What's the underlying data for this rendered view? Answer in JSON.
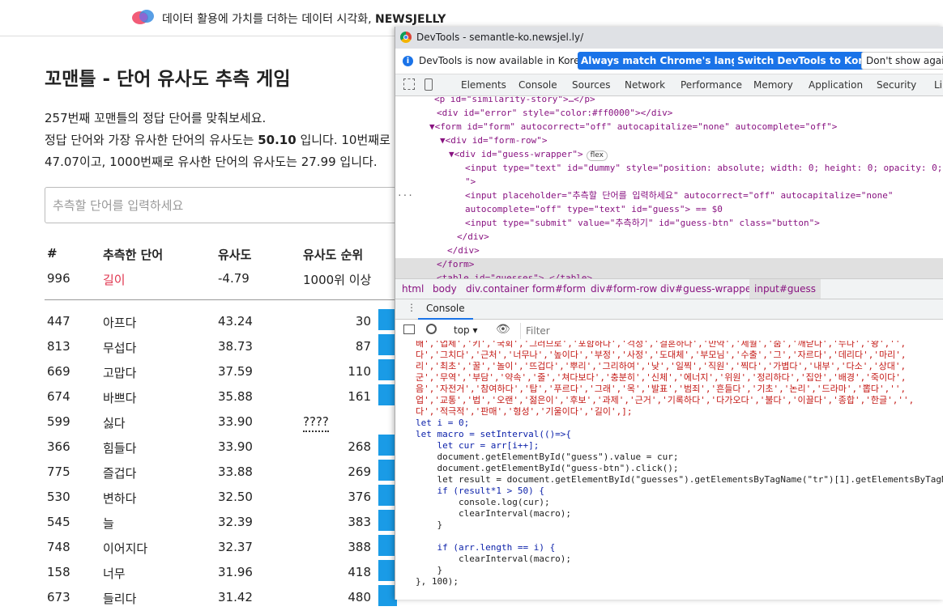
{
  "header": {
    "brand_text": "데이터 활용에 가치를 더하는 데이터 시각화, ",
    "brand_name": "NEWSJELLY"
  },
  "game": {
    "title": "꼬맨틀 - 단어 유사도 추측 게임",
    "intro_line1": "257번째 꼬맨틀의 정답 단어를 맞춰보세요.",
    "intro_line2_a": "정답 단어와 가장 유사한 단어의 유사도는 ",
    "intro_line2_b": "50.10",
    "intro_line2_c": " 입니다. 10번째로",
    "intro_line3": "47.07이고, 1000번째로 유사한 단어의 유사도는 27.99 입니다.",
    "input_placeholder": "추측할 단어를 입력하세요",
    "headers": {
      "num": "#",
      "word": "추측한 단어",
      "sim": "유사도",
      "rank": "유사도 순위"
    },
    "latest": {
      "num": "996",
      "word": "길이",
      "sim": "-4.79",
      "rank": "1000위 이상"
    },
    "rows": [
      {
        "num": "447",
        "word": "아프다",
        "sim": "43.24",
        "rank": "30"
      },
      {
        "num": "813",
        "word": "무섭다",
        "sim": "38.73",
        "rank": "87"
      },
      {
        "num": "669",
        "word": "고맙다",
        "sim": "37.59",
        "rank": "110"
      },
      {
        "num": "674",
        "word": "바쁘다",
        "sim": "35.88",
        "rank": "161"
      },
      {
        "num": "599",
        "word": "싫다",
        "sim": "33.90",
        "rank": "????"
      },
      {
        "num": "366",
        "word": "힘들다",
        "sim": "33.90",
        "rank": "268"
      },
      {
        "num": "775",
        "word": "즐겁다",
        "sim": "33.88",
        "rank": "269"
      },
      {
        "num": "530",
        "word": "변하다",
        "sim": "32.50",
        "rank": "376"
      },
      {
        "num": "545",
        "word": "늘",
        "sim": "32.39",
        "rank": "383"
      },
      {
        "num": "748",
        "word": "이어지다",
        "sim": "32.37",
        "rank": "388"
      },
      {
        "num": "158",
        "word": "너무",
        "sim": "31.96",
        "rank": "418"
      },
      {
        "num": "673",
        "word": "들리다",
        "sim": "31.42",
        "rank": "480"
      }
    ]
  },
  "devtools": {
    "window_title": "DevTools - semantle-ko.newsjel.ly/",
    "info_text": "DevTools is now available in Korean!",
    "btn_match": "Always match Chrome's language",
    "btn_switch": "Switch DevTools to Korean",
    "btn_dont": "Don't show again",
    "tabs": [
      "Elements",
      "Console",
      "Sources",
      "Network",
      "Performance",
      "Memory",
      "Application",
      "Security",
      "Li"
    ],
    "flex_badge": "flex",
    "breadcrumbs": [
      "html",
      "body",
      "div.container",
      "form#form",
      "div#form-row",
      "div#guess-wrapper",
      "input#guess"
    ],
    "console_tab": "Console",
    "context": "top",
    "filter_placeholder": "Filter",
    "element_lines": [
      "<p id=\"similarity-story\">…</p>",
      "<div id=\"error\" style=\"color:#ff0000\"></div>",
      "▼<form id=\"form\" autocorrect=\"off\" autocapitalize=\"none\" autocomplete=\"off\">",
      "▼<div id=\"form-row\">",
      "▼<div id=\"guess-wrapper\">",
      "<input type=\"text\" id=\"dummy\" style=\"position: absolute; width: 0; height: 0; opacity: 0;",
      "\">",
      "<input placeholder=\"추측할 단어를 입력하세요\" autocorrect=\"off\" autocapitalize=\"none\"",
      "autocomplete=\"off\" type=\"text\" id=\"guess\"> == $0",
      "<input type=\"submit\" value=\"추측하기\" id=\"guess-btn\" class=\"button\">",
      "</div>",
      "</div>",
      "</form>",
      "<table id=\"guesses\">…</table>"
    ],
    "console_lines": [
      "배','업체','키','국회','그러므로','포함하다','걱정','결혼하다','만약','세월','숨','깨닫다','누나','왕','',",
      "다','그치다','근처','너무나','높이다','부정','사정','도대체','부모님','수출','그','자르다','데리다','마리',",
      "리','최초','꿀','놀이','뜨겁다','뿌리','그리하여','낮','일찍','직원','찍다','가볍다','내부','다소','상대',",
      "군','무역','부담','약속','줄','쳐다보다','충분히','신체','에너지','위원','정리하다','집안','배경','죽이다',",
      "음','자전거','참여하다','탑','푸르다','그래','목','발표','범죄','흔들다','기초','논리','드라마','뽑다','',",
      "업','교통','법','오랜','젊은이','후보','과제','근거','기록하다','다가오다','불다','이끌다','종합','한글','',",
      "다','적극적','판매','형성','기울이다','길이',];",
      "let i = 0;",
      "let macro = setInterval(()=>{",
      "    let cur = arr[i++];",
      "    document.getElementById(\"guess\").value = cur;",
      "    document.getElementById(\"guess-btn\").click();",
      "    let result = document.getElementById(\"guesses\").getElementsByTagName(\"tr\")[1].getElementsByTagNa",
      "    if (result*1 > 50) {",
      "        console.log(cur);",
      "        clearInterval(macro);",
      "    }",
      "",
      "    if (arr.length == i) {",
      "        clearInterval(macro);",
      "    }",
      "}, 100);"
    ]
  }
}
